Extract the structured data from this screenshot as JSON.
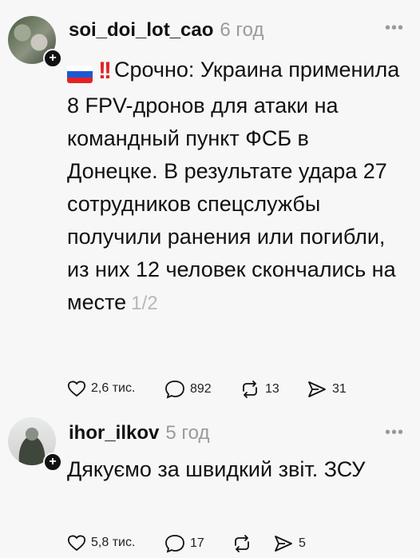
{
  "posts": [
    {
      "username": "soi_doi_lot_cao",
      "time": "6 год",
      "flag_emoji": "🇷🇺‼️",
      "text": "Срочно: Украина применила 8 FPV-дронов для атаки на командный пункт ФСБ в Донецке. В результате удара 27 сотрудников спецслужбы получили ранения или погибли, из них 12 человек скончались на месте",
      "page_indicator": "1/2",
      "likes": "2,6 тис.",
      "comments": "892",
      "reposts": "13",
      "shares": "31"
    },
    {
      "username": "ihor_ilkov",
      "time": "5 год",
      "text": "Дякуємо за швидкий звіт. ЗСУ",
      "likes": "5,8 тис.",
      "comments": "17",
      "reposts": "",
      "shares": "5"
    }
  ],
  "icons": {
    "like": "heart-icon",
    "comment": "comment-icon",
    "repost": "repost-icon",
    "share": "send-icon",
    "more": "more-icon"
  },
  "colors": {
    "background": "#f7f7f7",
    "muted": "#9a9a9a",
    "flag_white": "#ffffff",
    "flag_blue": "#1c57d6",
    "flag_red": "#e52222"
  }
}
